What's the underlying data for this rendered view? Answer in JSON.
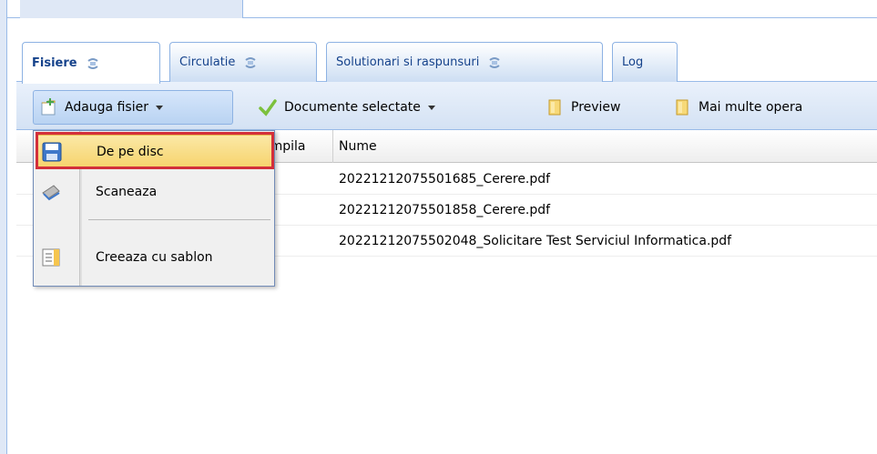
{
  "tabs": [
    {
      "label": "Fisiere",
      "active": true
    },
    {
      "label": "Circulatie",
      "active": false
    },
    {
      "label": "Solutionari si raspunsuri",
      "active": false
    },
    {
      "label": "Log",
      "active": false
    }
  ],
  "toolbar": {
    "add_file": "Adauga fisier",
    "selected_docs": "Documente selectate",
    "preview": "Preview",
    "more_ops": "Mai multe opera"
  },
  "grid": {
    "columns": [
      "ampila",
      "Nume"
    ],
    "rows": [
      "20221212075501685_Cerere.pdf",
      "20221212075501858_Cerere.pdf",
      "20221212075502048_Solicitare Test Serviciul Informatica.pdf"
    ]
  },
  "menu": {
    "items": [
      {
        "label": "De pe disc",
        "icon": "floppy-disk-icon",
        "active": true
      },
      {
        "label": "Scaneaza",
        "icon": "scanner-icon",
        "active": false
      },
      {
        "label": "Creeaza cu sablon",
        "icon": "template-icon",
        "active": false
      }
    ]
  },
  "colors": {
    "accent": "#15428b",
    "highlight_border": "#d32f3a",
    "menu_active": "#f6d36b"
  }
}
